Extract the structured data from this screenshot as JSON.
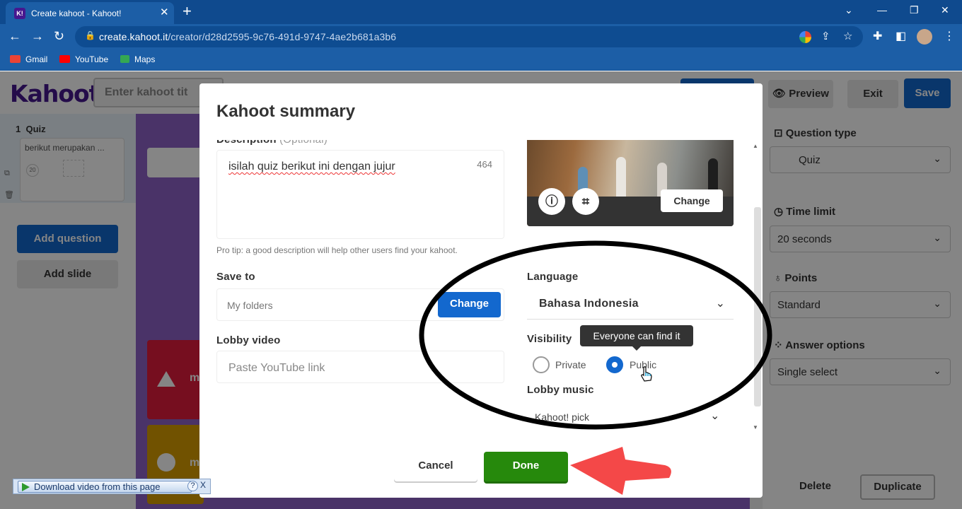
{
  "browser": {
    "tab_title": "Create kahoot - Kahoot!",
    "tab_favicon": "K!",
    "url_host": "create.kahoot.it",
    "url_path": "/creator/d28d2595-9c76-491d-9747-4ae2b681a3b6",
    "bookmarks": [
      {
        "label": "Gmail",
        "color": "#ea4335"
      },
      {
        "label": "YouTube",
        "color": "#ff0000"
      },
      {
        "label": "Maps",
        "color": "#34a853"
      }
    ]
  },
  "app": {
    "logo": "Kahoot!",
    "title_placeholder": "Enter kahoot tit",
    "preview_label": "Preview",
    "exit_label": "Exit",
    "save_label": "Save",
    "slide_number": "1",
    "slide_type": "Quiz",
    "slide_preview_text": "berikut merupakan ...",
    "thumb_timer": "20",
    "add_question_label": "Add question",
    "add_slide_label": "Add slide",
    "answer_labels": [
      "m",
      "m"
    ],
    "right_panel": {
      "question_type_label": "Question type",
      "question_type_value": "Quiz",
      "time_limit_label": "Time limit",
      "time_limit_value": "20 seconds",
      "points_label": "Points",
      "points_value": "Standard",
      "answer_options_label": "Answer options",
      "answer_options_value": "Single select",
      "delete_label": "Delete",
      "duplicate_label": "Duplicate"
    }
  },
  "modal": {
    "title": "Kahoot summary",
    "description_label": "Description",
    "description_optional": "(Optional)",
    "description_value": "isilah quiz berikut ini dengan jujur",
    "description_remaining": "464",
    "pro_tip": "Pro tip: a good description will help other users find your kahoot.",
    "save_to_label": "Save to",
    "save_to_value": "My folders",
    "save_to_change": "Change",
    "lobby_video_label": "Lobby video",
    "lobby_video_placeholder": "Paste YouTube link",
    "cover_change": "Change",
    "language_label": "Language",
    "language_value": "Bahasa Indonesia",
    "visibility_label": "Visibility",
    "visibility_tooltip": "Everyone can find it",
    "visibility_options": [
      {
        "label": "Private",
        "selected": false
      },
      {
        "label": "Public",
        "selected": true
      }
    ],
    "lobby_music_label": "Lobby music",
    "lobby_music_value": "Kahoot! pick",
    "cancel_label": "Cancel",
    "done_label": "Done"
  },
  "download_bar": {
    "label": "Download video from this page",
    "help": "?",
    "close": "X"
  },
  "colors": {
    "kahoot_purple": "#46178f",
    "primary_blue": "#1368ce",
    "done_green": "#26890c",
    "annotation_red": "#f44848",
    "annotation_black": "#000000"
  }
}
